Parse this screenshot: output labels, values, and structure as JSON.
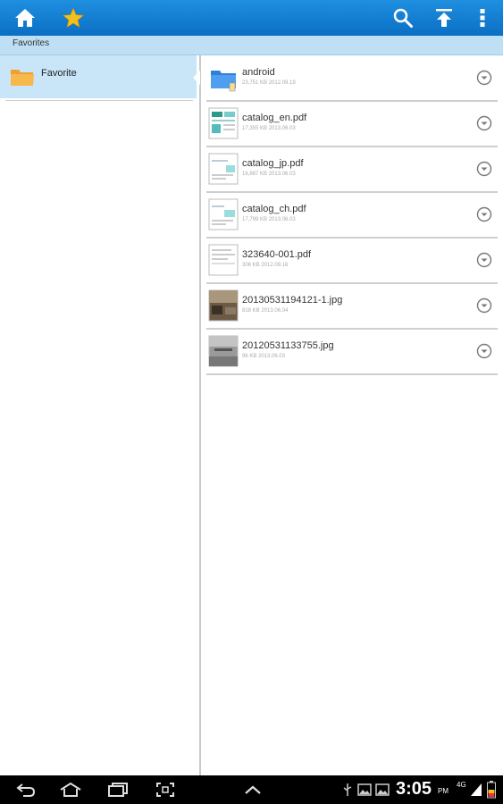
{
  "actionbar": {
    "icons": [
      "home-icon",
      "star-icon",
      "search-icon",
      "upload-icon",
      "overflow-menu-icon"
    ]
  },
  "pathbar": {
    "path": "Favorites"
  },
  "sidebar": {
    "items": [
      {
        "label": "Favorite",
        "icon": "folder-icon"
      }
    ]
  },
  "files": [
    {
      "name": "android",
      "meta": "23,751 KB 2012.09.19",
      "type": "folder"
    },
    {
      "name": "catalog_en.pdf",
      "meta": "17,355 KB 2013.06.03",
      "type": "pdf"
    },
    {
      "name": "catalog_jp.pdf",
      "meta": "16,887 KB 2013.06.03",
      "type": "pdf"
    },
    {
      "name": "catalog_ch.pdf",
      "meta": "17,799 KB 2013.06.03",
      "type": "pdf"
    },
    {
      "name": "323640-001.pdf",
      "meta": "306 KB 2012.09.16",
      "type": "pdf"
    },
    {
      "name": "20130531194121-1.jpg",
      "meta": "818 KB 2013.06.04",
      "type": "jpg"
    },
    {
      "name": "20120531133755.jpg",
      "meta": "96 KB 2013.06.03",
      "type": "jpg"
    }
  ],
  "statusbar": {
    "time": "3:05",
    "ampm": "PM",
    "network": "4G"
  },
  "colors": {
    "actionbar": "#0b6fc4",
    "star": "#f2c01e",
    "selection": "#c8e6f8"
  }
}
